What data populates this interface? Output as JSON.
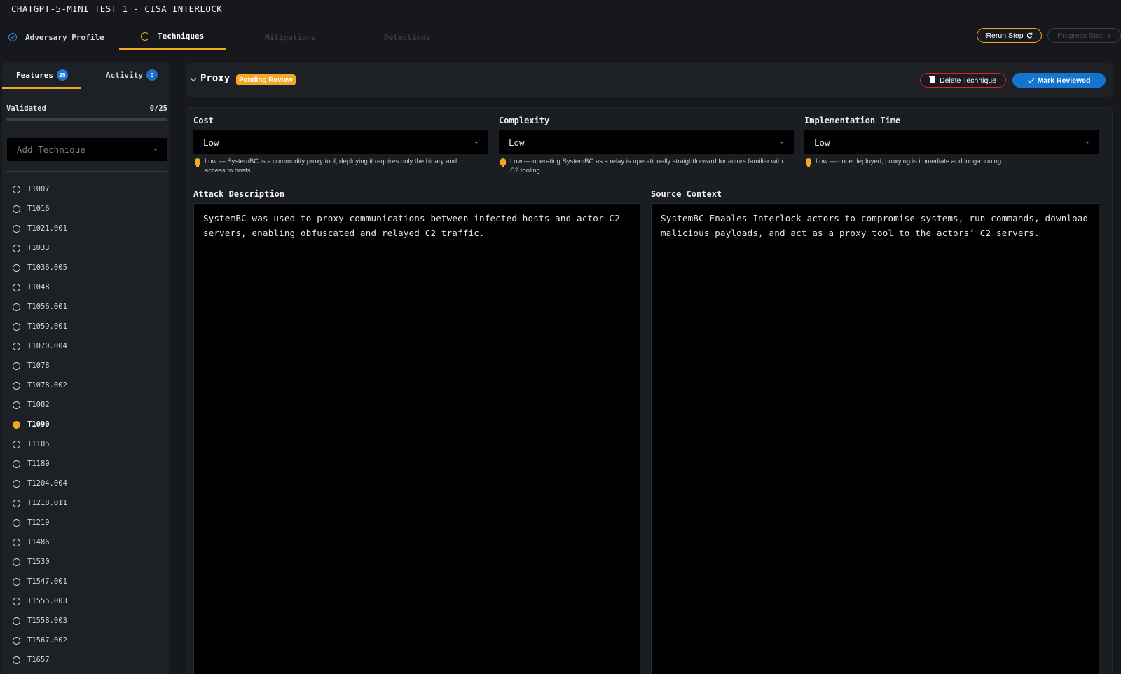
{
  "app": {
    "title": "CHATGPT-5-MINI TEST 1 - CISA INTERLOCK"
  },
  "steps": [
    {
      "label": "Adversary Profile",
      "state": "done"
    },
    {
      "label": "Techniques",
      "state": "active"
    },
    {
      "label": "Mitigations",
      "state": "disabled"
    },
    {
      "label": "Detections",
      "state": "disabled"
    }
  ],
  "actions": {
    "rerun_label": "Rerun Step",
    "progress_label": "Progress Step"
  },
  "sidebar": {
    "tabs": [
      {
        "label": "Features",
        "count": "25"
      },
      {
        "label": "Activity",
        "count": "0"
      }
    ],
    "validated_label": "Validated",
    "validated_count": "0/25",
    "validated_fraction": 0,
    "add_placeholder": "Add Technique",
    "techniques": [
      "T1007",
      "T1016",
      "T1021.001",
      "T1033",
      "T1036.005",
      "T1048",
      "T1056.001",
      "T1059.001",
      "T1070.004",
      "T1078",
      "T1078.002",
      "T1082",
      "T1090",
      "T1105",
      "T1189",
      "T1204.004",
      "T1218.011",
      "T1219",
      "T1486",
      "T1530",
      "T1547.001",
      "T1555.003",
      "T1558.003",
      "T1567.002",
      "T1657"
    ],
    "active_technique": "T1090"
  },
  "technique": {
    "name": "Proxy",
    "status": "Pending Review",
    "delete_label": "Delete Technique",
    "review_label": "Mark Reviewed",
    "cost": {
      "label": "Cost",
      "value": "Low",
      "hint": "Low — SystemBC is a commodity proxy tool; deploying it requires only the binary and access to hosts."
    },
    "complexity": {
      "label": "Complexity",
      "value": "Low",
      "hint": "Low — operating SystemBC as a relay is operationally straightforward for actors familiar with C2 tooling."
    },
    "implementation_time": {
      "label": "Implementation Time",
      "value": "Low",
      "hint": "Low — once deployed, proxying is immediate and long-running."
    },
    "attack_description": {
      "label": "Attack Description",
      "text": "SystemBC was used to proxy communications between infected hosts and actor C2 servers, enabling obfuscated and relayed C2 traffic."
    },
    "source_context": {
      "label": "Source Context",
      "text": "SystemBC Enables Interlock actors to compromise systems, run commands, download malicious payloads, and act as a proxy tool to the actors’ C2 servers."
    }
  },
  "colors": {
    "accent": "#f5a623",
    "primary": "#1475d0",
    "danger": "#e0202a"
  }
}
